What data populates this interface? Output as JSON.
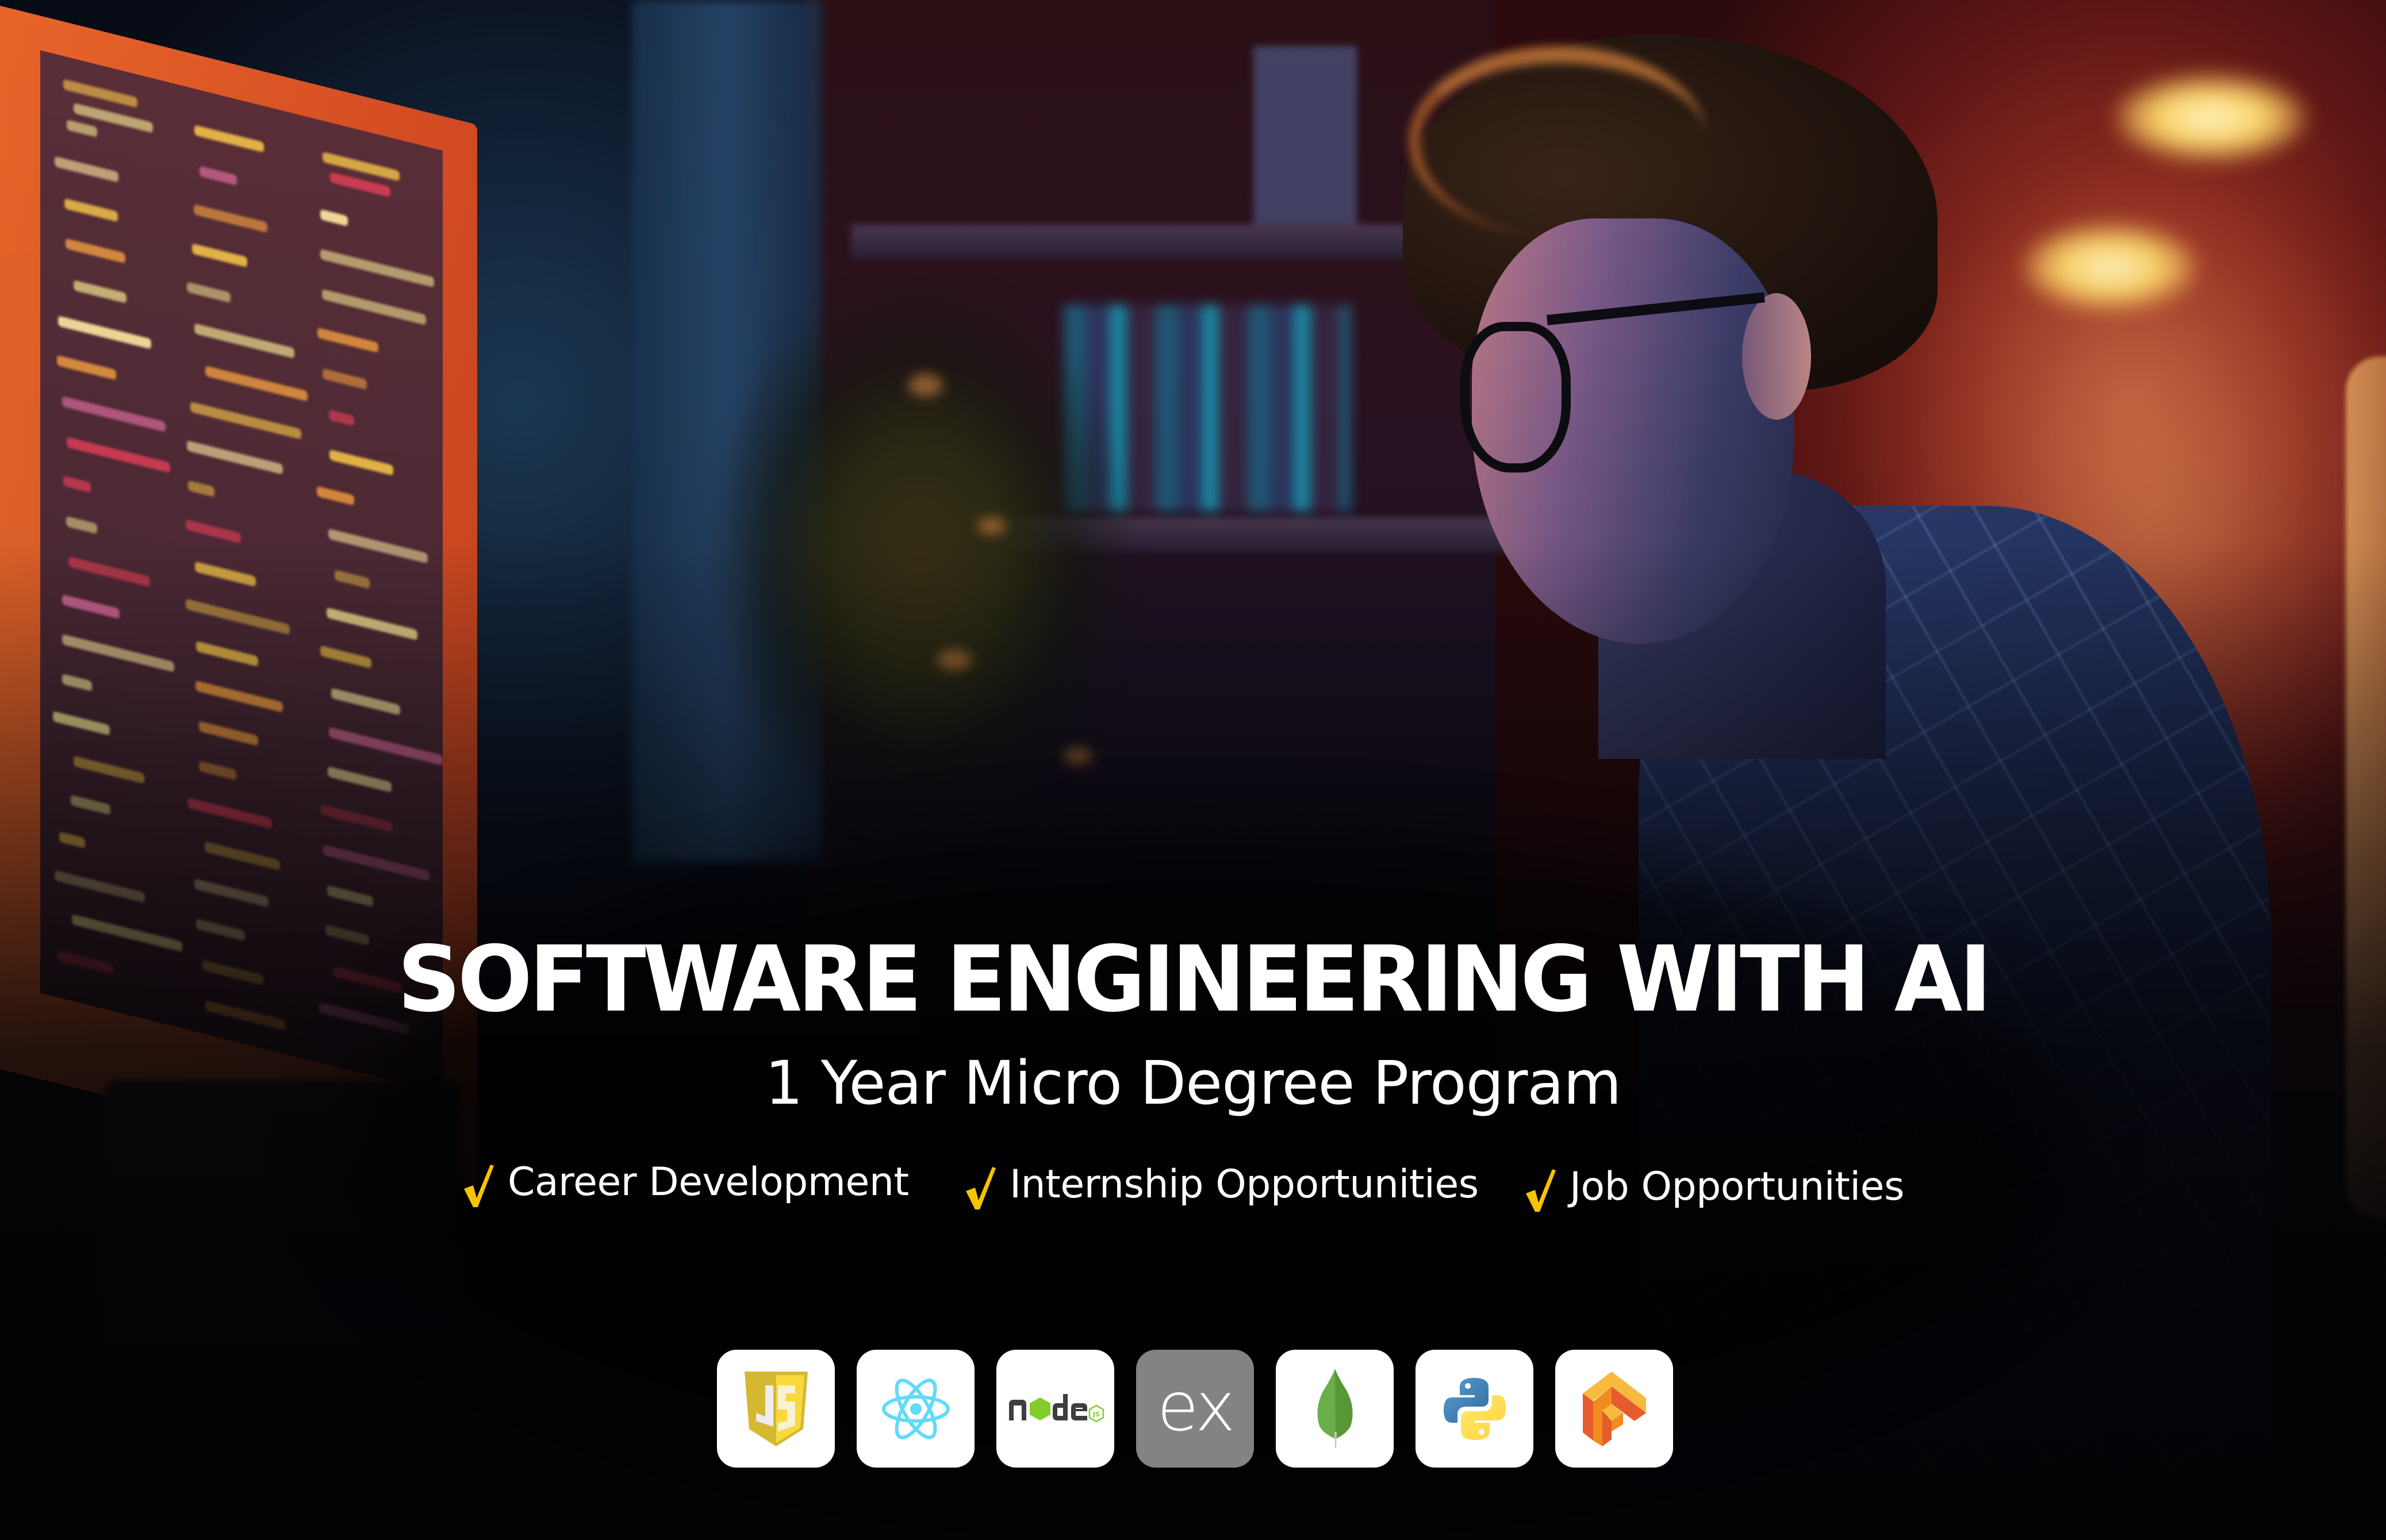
{
  "banner": {
    "title": "SOFTWARE ENGINEERING WITH AI",
    "subtitle": "1 Year Micro Degree Program",
    "accent_color": "#F5C400",
    "features": [
      {
        "icon": "check-icon",
        "label": "Career Development"
      },
      {
        "icon": "check-icon",
        "label": "Internship Opportunities"
      },
      {
        "icon": "check-icon",
        "label": "Job Opportunities"
      }
    ],
    "technologies": [
      {
        "name": "JavaScript",
        "icon": "javascript-logo-icon",
        "glyph": "JS"
      },
      {
        "name": "React",
        "icon": "react-logo-icon"
      },
      {
        "name": "Node.js",
        "icon": "nodejs-logo-icon",
        "glyph": "node"
      },
      {
        "name": "Express",
        "icon": "express-logo-icon",
        "glyph": "ex"
      },
      {
        "name": "MongoDB",
        "icon": "mongodb-leaf-icon"
      },
      {
        "name": "Python",
        "icon": "python-logo-icon"
      },
      {
        "name": "TensorFlow",
        "icon": "tensorflow-logo-icon"
      }
    ],
    "background_description": "Developer with glasses looking at a monitor full of code in a dimly lit room"
  }
}
